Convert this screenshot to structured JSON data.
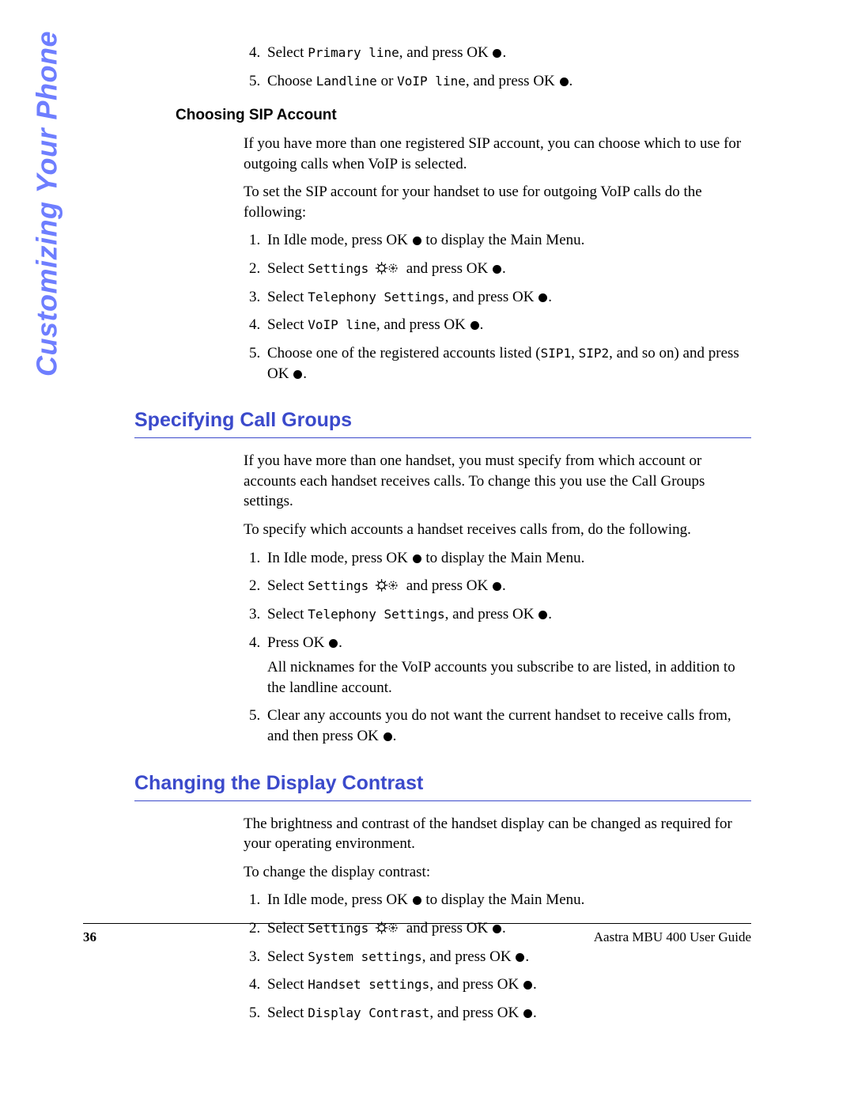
{
  "side_tab": "Customizing Your Phone",
  "top_steps_start": 4,
  "top_steps": [
    {
      "pre": "Select ",
      "menu": "Primary line",
      "post": ", and press OK ",
      "tail": "."
    },
    {
      "pre": "Choose ",
      "menu": "Landline",
      "mid": " or ",
      "menu2": "VoIP line",
      "post": ", and press OK ",
      "tail": "."
    }
  ],
  "h3_choose_sip": "Choosing SIP Account",
  "sip_p1": "If you have more than one registered SIP account, you can choose which to use for outgoing calls when VoIP is selected.",
  "sip_p2": "To set the SIP account for your handset to use for outgoing VoIP calls do the following:",
  "sip_steps": [
    {
      "pre": "In Idle mode, press OK ",
      "post": " to display the Main Menu."
    },
    {
      "pre": "Select ",
      "menu": "Settings",
      "icon": true,
      "mid": " and press OK ",
      "tail": "."
    },
    {
      "pre": "Select ",
      "menu": "Telephony Settings",
      "post": ", and press OK ",
      "tail": "."
    },
    {
      "pre": "Select ",
      "menu": "VoIP line",
      "post": ", and press OK ",
      "tail": "."
    },
    {
      "pre": "Choose one of the registered accounts listed (",
      "menu": "SIP1",
      "mid2": ", ",
      "menu2": "SIP2",
      "post2": ", and so on) and press OK ",
      "tail": "."
    }
  ],
  "h2_call_groups": "Specifying Call Groups",
  "cg_p1": "If you have more than one handset, you must specify from which account or accounts each handset receives calls. To change this you use the Call Groups settings.",
  "cg_p2": "To specify which accounts a handset receives calls from, do the following.",
  "cg_steps": [
    {
      "pre": "In Idle mode, press OK ",
      "post": " to display the Main Menu."
    },
    {
      "pre": "Select ",
      "menu": "Settings",
      "icon": true,
      "mid": " and press OK ",
      "tail": "."
    },
    {
      "pre": "Select ",
      "menu": "Telephony Settings",
      "post": ", and press OK ",
      "tail": "."
    },
    {
      "pre": "Press OK ",
      "tail": ".",
      "sub": "All nicknames for the VoIP accounts you subscribe to are listed, in addition to the landline account."
    },
    {
      "pre": "Clear any accounts you do not want the current handset to receive calls from, and then press OK ",
      "tail": "."
    }
  ],
  "h2_contrast": "Changing the Display Contrast",
  "dc_p1": "The brightness and contrast of the handset display can be changed as required for your operating environment.",
  "dc_p2": "To change the display contrast:",
  "dc_steps": [
    {
      "pre": "In Idle mode, press OK ",
      "post": " to display the Main Menu."
    },
    {
      "pre": "Select ",
      "menu": "Settings",
      "icon": true,
      "mid": " and press OK ",
      "tail": "."
    },
    {
      "pre": "Select ",
      "menu": "System settings",
      "post": ", and press OK ",
      "tail": "."
    },
    {
      "pre": "Select ",
      "menu": "Handset settings",
      "post": ", and press OK ",
      "tail": "."
    },
    {
      "pre": "Select ",
      "menu": "Display Contrast",
      "post": ", and press OK ",
      "tail": "."
    }
  ],
  "footer": {
    "page": "36",
    "guide": "Aastra MBU 400 User Guide"
  }
}
